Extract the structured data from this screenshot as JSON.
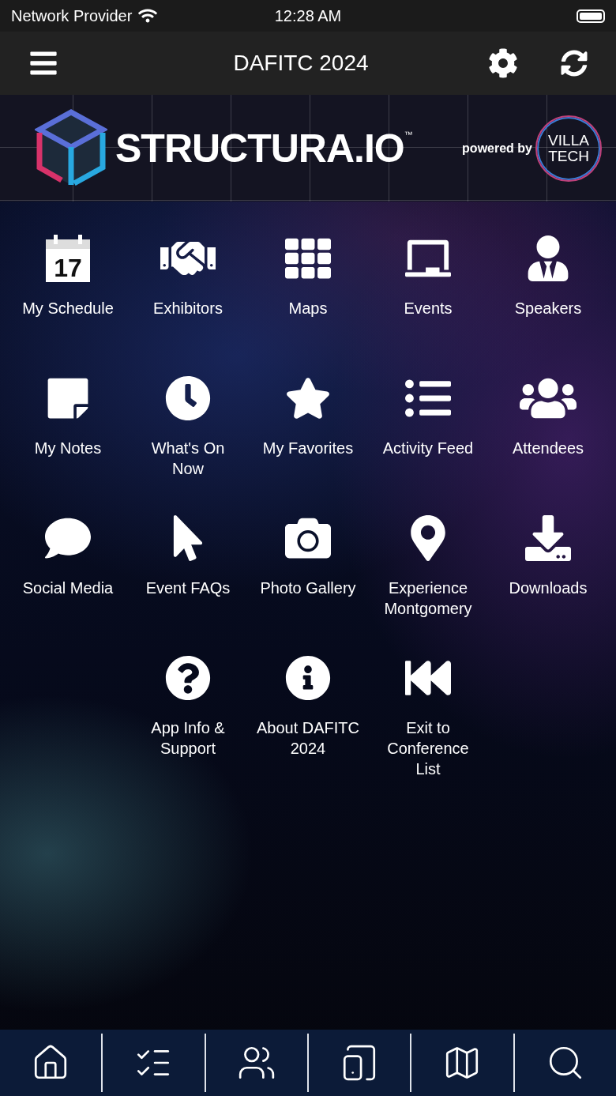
{
  "status_bar": {
    "carrier": "Network Provider",
    "time": "12:28 AM"
  },
  "nav_bar": {
    "title": "DAFITC 2024"
  },
  "banner": {
    "logo_text": "STRUCTURA.IO",
    "trademark": "™",
    "powered_by": "powered by",
    "partner_line_1": "VILLA",
    "partner_line_2": "TECH"
  },
  "menu_items": [
    {
      "label": "My Schedule",
      "icon_text": "17"
    },
    {
      "label": "Exhibitors"
    },
    {
      "label": "Maps"
    },
    {
      "label": "Events"
    },
    {
      "label": "Speakers"
    },
    {
      "label": "My Notes"
    },
    {
      "label": "What's On Now"
    },
    {
      "label": "My Favorites"
    },
    {
      "label": "Activity Feed"
    },
    {
      "label": "Attendees"
    },
    {
      "label": "Social Media"
    },
    {
      "label": "Event FAQs"
    },
    {
      "label": "Photo Gallery"
    },
    {
      "label": "Experience Montgomery"
    },
    {
      "label": "Downloads"
    },
    {
      "label": "App Info & Support"
    },
    {
      "label": "About DAFITC 2024"
    },
    {
      "label": "Exit to Conference List"
    }
  ]
}
